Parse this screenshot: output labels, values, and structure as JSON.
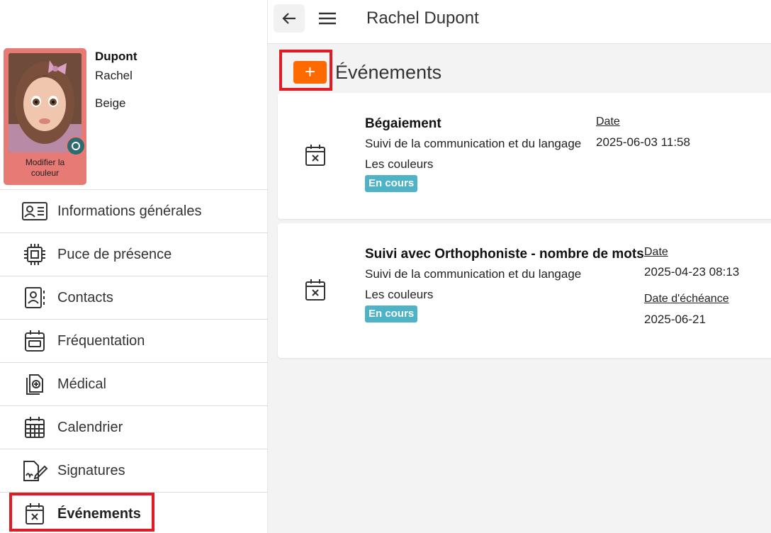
{
  "topbar": {
    "title": "Rachel Dupont"
  },
  "profile": {
    "last_name": "Dupont",
    "first_name": "Rachel",
    "group": "Beige",
    "photo_caption": "Modifier la couleur",
    "card_color": "#e87a76"
  },
  "menu": {
    "items": [
      {
        "label": "Informations générales",
        "icon": "id-card-icon"
      },
      {
        "label": "Puce de présence",
        "icon": "chip-icon"
      },
      {
        "label": "Contacts",
        "icon": "contacts-icon"
      },
      {
        "label": "Fréquentation",
        "icon": "attendance-calendar-icon"
      },
      {
        "label": "Médical",
        "icon": "medical-file-icon"
      },
      {
        "label": "Calendrier",
        "icon": "calendar-grid-icon"
      },
      {
        "label": "Signatures",
        "icon": "signature-icon"
      },
      {
        "label": "Événements",
        "icon": "calendar-x-icon",
        "active": true
      }
    ]
  },
  "main": {
    "section_title": "Événements",
    "add_label": "+",
    "accent_color": "#ff6a00",
    "events": [
      {
        "name": "Bégaiement",
        "category": "Suivi de la communication et du langage",
        "group": "Les couleurs",
        "status": "En cours",
        "date_label": "Date",
        "date_value": "2025-06-03 11:58"
      },
      {
        "name": "Suivi avec Orthophoniste - nombre de mots",
        "category": "Suivi de la communication et du langage",
        "group": "Les couleurs",
        "status": "En cours",
        "date_label": "Date",
        "date_value": "2025-04-23 08:13",
        "due_label": "Date d'échéance",
        "due_value": "2025-06-21"
      }
    ]
  }
}
